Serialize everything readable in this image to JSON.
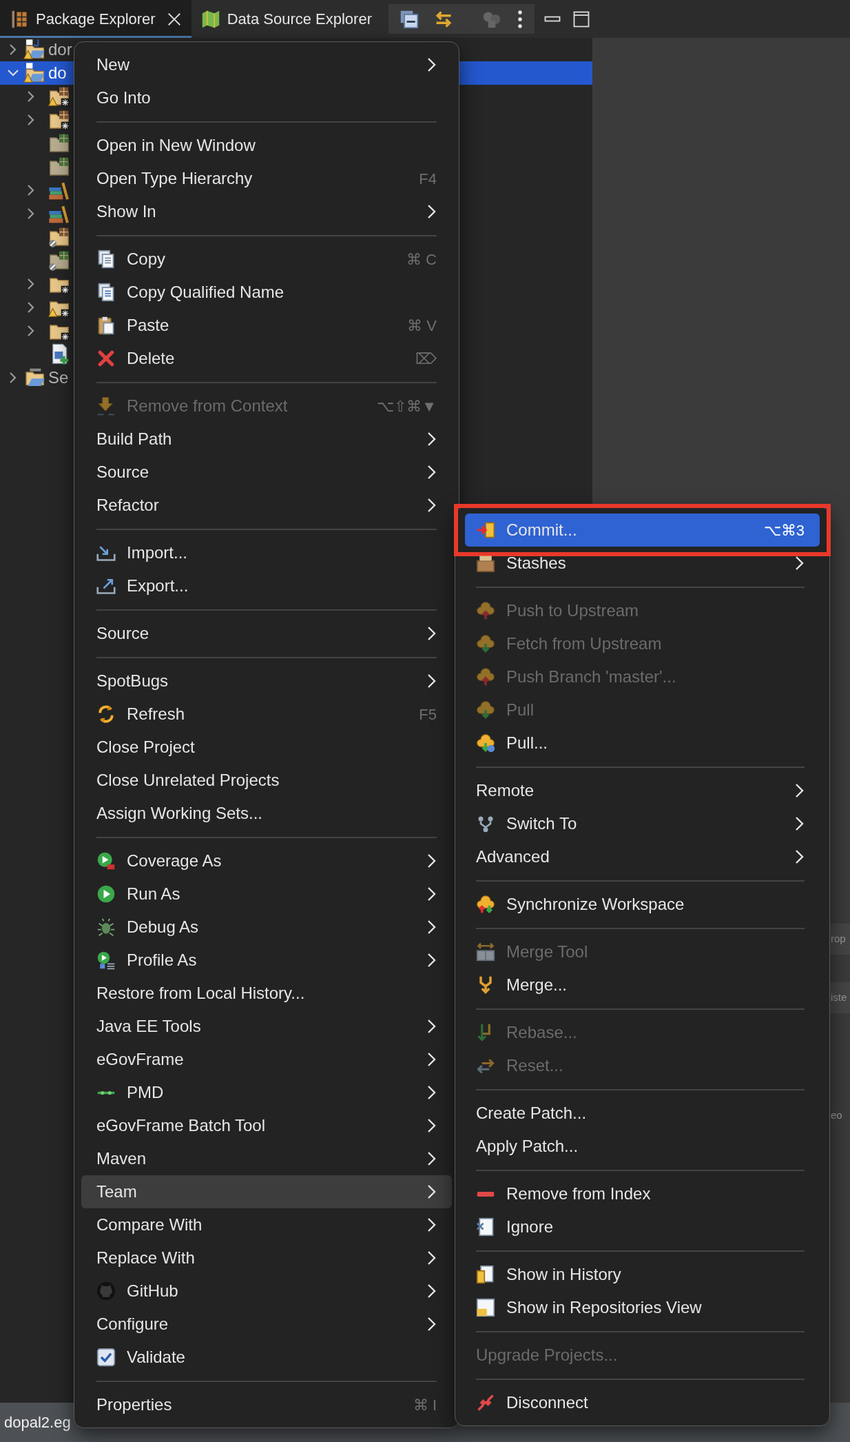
{
  "tabs": [
    {
      "label": "Package Explorer",
      "selected": true,
      "closable": true
    },
    {
      "label": "Data Source Explorer",
      "selected": false,
      "closable": false
    }
  ],
  "tree": {
    "items": [
      {
        "label": "dor",
        "kind": "project",
        "warning": true,
        "expanded": false,
        "selected": false
      },
      {
        "label": "do",
        "kind": "project",
        "warning": true,
        "expanded": true,
        "selected": true,
        "children": [
          {
            "kind": "source",
            "warning": true,
            "expanded": false,
            "selected": false
          },
          {
            "kind": "source",
            "warning": false,
            "expanded": false,
            "selected": false
          },
          {
            "kind": "resource",
            "warning": false,
            "selected": false
          },
          {
            "kind": "resource",
            "warning": false,
            "selected": false
          },
          {
            "kind": "library",
            "warning": false,
            "expanded": false,
            "selected": false
          },
          {
            "kind": "library",
            "warning": false,
            "expanded": false,
            "selected": false
          },
          {
            "kind": "excluded_source",
            "warning": false,
            "selected": false
          },
          {
            "kind": "excluded_resource",
            "warning": false,
            "selected": false
          },
          {
            "kind": "folder",
            "warning": false,
            "expanded": false,
            "selected": false
          },
          {
            "kind": "folder",
            "warning": true,
            "expanded": false,
            "selected": false
          },
          {
            "kind": "folder",
            "warning": false,
            "expanded": false,
            "selected": false
          },
          {
            "kind": "file",
            "warning": false,
            "selected": false
          }
        ]
      },
      {
        "label": "Se",
        "kind": "server",
        "warning": false,
        "expanded": false,
        "selected": false
      }
    ]
  },
  "context_menu": {
    "items": [
      {
        "kind": "item",
        "label": "New",
        "submenu": true,
        "disabled": false,
        "selected": false
      },
      {
        "kind": "item",
        "label": "Go Into",
        "submenu": false,
        "disabled": false,
        "selected": false
      },
      {
        "kind": "separator"
      },
      {
        "kind": "item",
        "label": "Open in New Window",
        "submenu": false,
        "disabled": false,
        "selected": false
      },
      {
        "kind": "item",
        "label": "Open Type Hierarchy",
        "shortcut": "F4",
        "submenu": false,
        "disabled": false,
        "selected": false
      },
      {
        "kind": "item",
        "label": "Show In",
        "submenu": true,
        "disabled": false,
        "selected": false
      },
      {
        "kind": "separator"
      },
      {
        "kind": "item",
        "label": "Copy",
        "shortcut": "⌘ C",
        "submenu": false,
        "disabled": false,
        "selected": false
      },
      {
        "kind": "item",
        "label": "Copy Qualified Name",
        "submenu": false,
        "disabled": false,
        "selected": false
      },
      {
        "kind": "item",
        "label": "Paste",
        "shortcut": "⌘ V",
        "submenu": false,
        "disabled": false,
        "selected": false
      },
      {
        "kind": "item",
        "label": "Delete",
        "shortcut": "⌦",
        "submenu": false,
        "disabled": false,
        "selected": false
      },
      {
        "kind": "separator"
      },
      {
        "kind": "item",
        "label": "Remove from Context",
        "shortcut": "⌥⇧⌘▼",
        "submenu": false,
        "disabled": true,
        "selected": false
      },
      {
        "kind": "item",
        "label": "Build Path",
        "submenu": true,
        "disabled": false,
        "selected": false
      },
      {
        "kind": "item",
        "label": "Source",
        "submenu": true,
        "disabled": false,
        "selected": false
      },
      {
        "kind": "item",
        "label": "Refactor",
        "submenu": true,
        "disabled": false,
        "selected": false
      },
      {
        "kind": "separator"
      },
      {
        "kind": "item",
        "label": "Import...",
        "submenu": false,
        "disabled": false,
        "selected": false
      },
      {
        "kind": "item",
        "label": "Export...",
        "submenu": false,
        "disabled": false,
        "selected": false
      },
      {
        "kind": "separator"
      },
      {
        "kind": "item",
        "label": "Source",
        "submenu": true,
        "disabled": false,
        "selected": false
      },
      {
        "kind": "separator"
      },
      {
        "kind": "item",
        "label": "SpotBugs",
        "submenu": true,
        "disabled": false,
        "selected": false
      },
      {
        "kind": "item",
        "label": "Refresh",
        "shortcut": "F5",
        "submenu": false,
        "disabled": false,
        "selected": false
      },
      {
        "kind": "item",
        "label": "Close Project",
        "submenu": false,
        "disabled": false,
        "selected": false
      },
      {
        "kind": "item",
        "label": "Close Unrelated Projects",
        "submenu": false,
        "disabled": false,
        "selected": false
      },
      {
        "kind": "item",
        "label": "Assign Working Sets...",
        "submenu": false,
        "disabled": false,
        "selected": false
      },
      {
        "kind": "separator"
      },
      {
        "kind": "item",
        "label": "Coverage As",
        "submenu": true,
        "disabled": false,
        "selected": false
      },
      {
        "kind": "item",
        "label": "Run As",
        "submenu": true,
        "disabled": false,
        "selected": false
      },
      {
        "kind": "item",
        "label": "Debug As",
        "submenu": true,
        "disabled": false,
        "selected": false
      },
      {
        "kind": "item",
        "label": "Profile As",
        "submenu": true,
        "disabled": false,
        "selected": false
      },
      {
        "kind": "item",
        "label": "Restore from Local History...",
        "submenu": false,
        "disabled": false,
        "selected": false
      },
      {
        "kind": "item",
        "label": "Java EE Tools",
        "submenu": true,
        "disabled": false,
        "selected": false
      },
      {
        "kind": "item",
        "label": "eGovFrame",
        "submenu": true,
        "disabled": false,
        "selected": false
      },
      {
        "kind": "item",
        "label": "PMD",
        "submenu": true,
        "disabled": false,
        "selected": false
      },
      {
        "kind": "item",
        "label": "eGovFrame Batch Tool",
        "submenu": true,
        "disabled": false,
        "selected": false
      },
      {
        "kind": "item",
        "label": "Maven",
        "submenu": true,
        "disabled": false,
        "selected": false
      },
      {
        "kind": "item",
        "label": "Team",
        "submenu": true,
        "disabled": false,
        "selected": true
      },
      {
        "kind": "item",
        "label": "Compare With",
        "submenu": true,
        "disabled": false,
        "selected": false
      },
      {
        "kind": "item",
        "label": "Replace With",
        "submenu": true,
        "disabled": false,
        "selected": false
      },
      {
        "kind": "item",
        "label": "GitHub",
        "submenu": true,
        "disabled": false,
        "selected": false
      },
      {
        "kind": "item",
        "label": "Configure",
        "submenu": true,
        "disabled": false,
        "selected": false
      },
      {
        "kind": "checkbox",
        "label": "Validate",
        "checked": true,
        "submenu": false,
        "disabled": false,
        "selected": false
      },
      {
        "kind": "separator"
      },
      {
        "kind": "item",
        "label": "Properties",
        "shortcut": "⌘ I",
        "submenu": false,
        "disabled": false,
        "selected": false
      }
    ]
  },
  "team_submenu": {
    "items": [
      {
        "kind": "item",
        "label": "Commit...",
        "shortcut": "⌥⌘3",
        "submenu": false,
        "disabled": false,
        "selected": true,
        "outlined": true
      },
      {
        "kind": "item",
        "label": "Stashes",
        "submenu": true,
        "disabled": false,
        "selected": false,
        "outlined": false
      },
      {
        "kind": "separator"
      },
      {
        "kind": "item",
        "label": "Push to Upstream",
        "submenu": false,
        "disabled": true,
        "selected": false,
        "outlined": false
      },
      {
        "kind": "item",
        "label": "Fetch from Upstream",
        "submenu": false,
        "disabled": true,
        "selected": false,
        "outlined": false
      },
      {
        "kind": "item",
        "label": "Push Branch 'master'...",
        "submenu": false,
        "disabled": true,
        "selected": false,
        "outlined": false
      },
      {
        "kind": "item",
        "label": "Pull",
        "submenu": false,
        "disabled": true,
        "selected": false,
        "outlined": false
      },
      {
        "kind": "item",
        "label": "Pull...",
        "submenu": false,
        "disabled": false,
        "selected": false,
        "outlined": false
      },
      {
        "kind": "separator"
      },
      {
        "kind": "item",
        "label": "Remote",
        "submenu": true,
        "disabled": false,
        "selected": false,
        "outlined": false
      },
      {
        "kind": "item",
        "label": "Switch To",
        "submenu": true,
        "disabled": false,
        "selected": false,
        "outlined": false
      },
      {
        "kind": "item",
        "label": "Advanced",
        "submenu": true,
        "disabled": false,
        "selected": false,
        "outlined": false
      },
      {
        "kind": "separator"
      },
      {
        "kind": "item",
        "label": "Synchronize Workspace",
        "submenu": false,
        "disabled": false,
        "selected": false,
        "outlined": false
      },
      {
        "kind": "separator"
      },
      {
        "kind": "item",
        "label": "Merge Tool",
        "submenu": false,
        "disabled": true,
        "selected": false,
        "outlined": false
      },
      {
        "kind": "item",
        "label": "Merge...",
        "submenu": false,
        "disabled": false,
        "selected": false,
        "outlined": false
      },
      {
        "kind": "separator"
      },
      {
        "kind": "item",
        "label": "Rebase...",
        "submenu": false,
        "disabled": true,
        "selected": false,
        "outlined": false
      },
      {
        "kind": "item",
        "label": "Reset...",
        "submenu": false,
        "disabled": true,
        "selected": false,
        "outlined": false
      },
      {
        "kind": "separator"
      },
      {
        "kind": "item",
        "label": "Create Patch...",
        "submenu": false,
        "disabled": false,
        "selected": false,
        "outlined": false
      },
      {
        "kind": "item",
        "label": "Apply Patch...",
        "submenu": false,
        "disabled": false,
        "selected": false,
        "outlined": false
      },
      {
        "kind": "separator"
      },
      {
        "kind": "item",
        "label": "Remove from Index",
        "submenu": false,
        "disabled": false,
        "selected": false,
        "outlined": false
      },
      {
        "kind": "item",
        "label": "Ignore",
        "submenu": false,
        "disabled": false,
        "selected": false,
        "outlined": false
      },
      {
        "kind": "separator"
      },
      {
        "kind": "item",
        "label": "Show in History",
        "submenu": false,
        "disabled": false,
        "selected": false,
        "outlined": false
      },
      {
        "kind": "item",
        "label": "Show in Repositories View",
        "submenu": false,
        "disabled": false,
        "selected": false,
        "outlined": false
      },
      {
        "kind": "separator"
      },
      {
        "kind": "item",
        "label": "Upgrade Projects...",
        "submenu": false,
        "disabled": true,
        "selected": false,
        "outlined": false
      },
      {
        "kind": "separator"
      },
      {
        "kind": "item",
        "label": "Disconnect",
        "submenu": false,
        "disabled": false,
        "selected": false,
        "outlined": false
      }
    ]
  },
  "background_fragments": [
    "rop",
    "iste",
    "eo"
  ],
  "status_bar": {
    "text": "dopal2.eg"
  }
}
